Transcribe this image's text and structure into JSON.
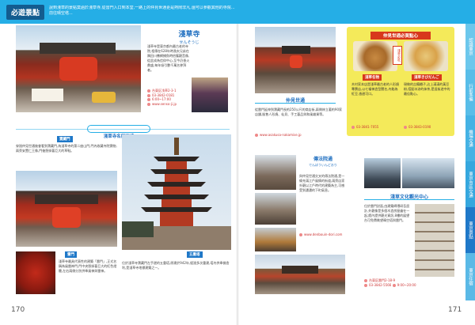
{
  "header": {
    "badge": "必遊景點",
    "intro": "說到淺草的景點莫過於淺草寺,從雷門入口到本堂,一路上的仲見世通更是熱鬧非凡,還可以參觀其他的寺院...前往晴空塔..."
  },
  "left_page": {
    "page_number": "170",
    "sensoji": {
      "title": "淺草寺",
      "reading": "せんそうじ",
      "body": "淺草寺是東京都內最古老的寺院,相傳在628年時漁夫兄弟在隅田川撒網捕魚時拾獲觀音像,從此成為信仰中心,至今仍香火鼎盛,每年吸引數千萬名參拜者。",
      "info": [
        "台東区浅草2-3-1",
        "03-3842-0181",
        "6:00~17:00",
        "www.senso-ji.jp"
      ]
    },
    "section_title": "淺草寺名所巡禮",
    "hozomon": {
      "label": "寶藏門",
      "body": "穿過仲見世通後會看到寶藏門,為淺草寺的第二座山門,門內收藏寺院寶物,兩旁安置仁王像,門後懸掛著巨大的草鞋。"
    },
    "kaminarimon": {
      "label": "雷門",
      "body": "淺草寺最具代表性的建築「雷門」,正式名稱為風雷神門,門中央懸掛著巨大的紅色燈籠,左右兩側分別供奉風神與雷神。"
    },
    "pagoda": {
      "label": "五重塔",
      "body": "位於淺草寺寶藏門左手邊的五重塔,原建於942年,經過多次重建,塔內供奉佛舍利,是淺草寺地標建築之一。"
    }
  },
  "right_page": {
    "page_number": "171",
    "nakamise": {
      "title": "仲見世通",
      "body": "從雷門延伸到寶藏門長約250公尺的商店街,兩側林立著約90家店舖,販售人形燒、仙貝、手工藝品與和風雜貨等。",
      "info": "www.asakusa-nakamise.jp"
    },
    "snack_box": {
      "title": "仲見世通必買點心",
      "item1_label": "淺草名物",
      "item1_body": "木村家本店是淺草最古老的人形燒專賣店,以七福神造型聞名,內餡為紅豆,香甜可口。",
      "item1_tel": "03-3841-7055",
      "item2_label": "淺草きびだんご",
      "item2_body": "現做的吉備糰子,沾上滿滿的黃豆粉,搭配冰涼的抹茶,是逛街途中的最佳點心。",
      "item2_tel": "03-3843-0190",
      "tag": "淺草必吃"
    },
    "denbouin": {
      "title": "傳法院通",
      "reading": "でんぼういんどおり",
      "body": "與仲見世通交叉的傳法院通,是一條充滿江戶風情的街道,兩旁店家外觀以江戶時代的建築為主,可感受到濃濃的下町氣息。",
      "info": "www.denbouin-dori.com"
    },
    "culture_center": {
      "title": "淺草文化觀光中心",
      "body": "位於雷門對面,由建築師隈研吾設計,外觀像是多個木造房屋疊在一起,館內提供觀光資訊,8樓的展望台可免費眺望晴空塔與雷門。",
      "info": [
        "台東区雷門2-18-9",
        "03-3842-5566",
        "9:00~20:00"
      ]
    },
    "side_tabs": [
      "認識東京",
      "行前準備",
      "機場交通",
      "東京市區交通",
      "東京景點",
      "東京住宿"
    ]
  },
  "colors": {
    "accent": "#25aee6",
    "title_blue": "#1f6fc0",
    "yellow_box": "#f4ea5a",
    "tab_active": "#1f78c8"
  }
}
